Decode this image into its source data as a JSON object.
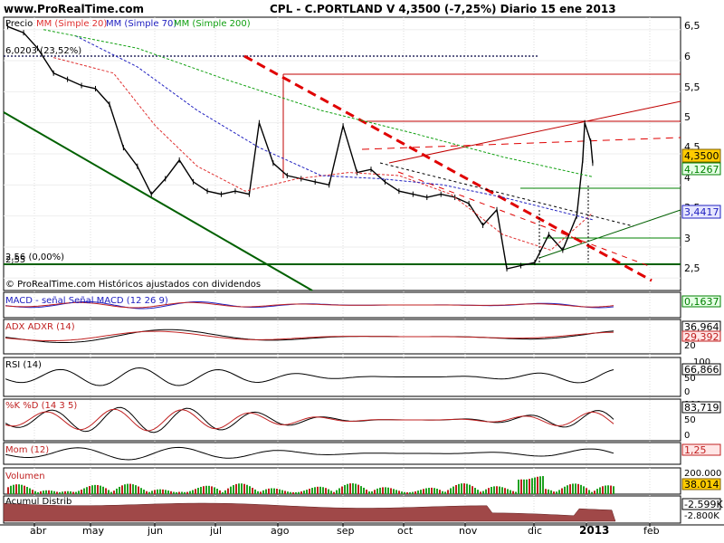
{
  "header": {
    "site": "www.ProRealTime.com",
    "title": "CPL - C.PORTLAND V    4,3500 (-7,25%)   Diario  15 ene 2013"
  },
  "main_panel": {
    "legend": [
      {
        "text": "Precio",
        "color": "#000000"
      },
      {
        "text": "MM (Simple 20)",
        "color": "#e03030"
      },
      {
        "text": "MM (Simple 70)",
        "color": "#2020c0"
      },
      {
        "text": "MM (Simple 200)",
        "color": "#10a010"
      }
    ],
    "annotations": {
      "fib_top": "6,0203 (23,52%)",
      "fib_bottom": "2,56 (0,00%)",
      "fib_bottom_shadow": "2,55",
      "watermark": "© ProRealTime.com Históricos ajustados con dividendos"
    },
    "y_ticks": [
      "6,5",
      "6",
      "5,5",
      "5",
      "4,5",
      "4",
      "3,5",
      "3",
      "2,5"
    ],
    "value_tags": [
      {
        "text": "4,3500",
        "bg": "#ffcc00",
        "fg": "#000000",
        "border": "#806000"
      },
      {
        "text": "4,1267",
        "bg": "#e6ffe6",
        "fg": "#008000",
        "border": "#008000"
      },
      {
        "text": "3,4417",
        "bg": "#e6e6ff",
        "fg": "#2020c0",
        "border": "#2020c0"
      }
    ]
  },
  "indicators": [
    {
      "label": "MACD - señal Señal MACD (12 26 9)",
      "value": "0,1637",
      "value_color": "#008000",
      "axis": []
    },
    {
      "label": "ADX  ADXR (14)",
      "value": "36,964",
      "value_color": "#000000",
      "value2": "29,392",
      "axis": [
        "40",
        "20"
      ]
    },
    {
      "label": "RSI (14)",
      "value": "66,866",
      "value_color": "#000000",
      "axis": [
        "100",
        "50",
        "0"
      ]
    },
    {
      "label": "%K  %D (14 3 5)",
      "value": "83,719",
      "value_color": "#000000",
      "axis": [
        "100",
        "50",
        "0"
      ]
    },
    {
      "label": "Mom (12)",
      "value": "1,25",
      "value_color": "#c02020",
      "axis": []
    },
    {
      "label": "Volumen",
      "value": "38.014",
      "value_color": "#000000",
      "axis": [
        "200.000"
      ]
    },
    {
      "label": "Acumul Distrib",
      "value": "-2.599K",
      "value_color": "#000000",
      "axis": [
        "-2.800K"
      ]
    }
  ],
  "x_axis": {
    "months": [
      "abr",
      "may",
      "jun",
      "jul",
      "ago",
      "sep",
      "oct",
      "nov",
      "dic",
      "2013",
      "feb"
    ]
  },
  "chart_data": {
    "type": "line",
    "title": "CPL - C.PORTLAND V    4,3500 (-7,25%)   Diario  15 ene 2013",
    "x_label": "",
    "y_label": "",
    "ylim": [
      2.3,
      6.7
    ],
    "x_range": [
      "2012-03-26",
      "2013-02-28"
    ],
    "series": [
      {
        "name": "Precio",
        "color": "#000000",
        "points": [
          [
            "2012-03-28",
            6.55
          ],
          [
            "2012-04-05",
            6.45
          ],
          [
            "2012-04-12",
            6.2
          ],
          [
            "2012-04-20",
            5.8
          ],
          [
            "2012-04-27",
            5.7
          ],
          [
            "2012-05-04",
            5.6
          ],
          [
            "2012-05-11",
            5.55
          ],
          [
            "2012-05-18",
            5.3
          ],
          [
            "2012-05-25",
            4.6
          ],
          [
            "2012-06-01",
            4.3
          ],
          [
            "2012-06-08",
            3.85
          ],
          [
            "2012-06-15",
            4.1
          ],
          [
            "2012-06-22",
            4.4
          ],
          [
            "2012-06-29",
            4.05
          ],
          [
            "2012-07-06",
            3.9
          ],
          [
            "2012-07-13",
            3.85
          ],
          [
            "2012-07-20",
            3.9
          ],
          [
            "2012-07-27",
            3.85
          ],
          [
            "2012-08-01",
            5.0
          ],
          [
            "2012-08-08",
            4.35
          ],
          [
            "2012-08-15",
            4.15
          ],
          [
            "2012-08-22",
            4.1
          ],
          [
            "2012-08-29",
            4.05
          ],
          [
            "2012-09-05",
            4.0
          ],
          [
            "2012-09-12",
            4.95
          ],
          [
            "2012-09-19",
            4.2
          ],
          [
            "2012-09-26",
            4.25
          ],
          [
            "2012-10-03",
            4.05
          ],
          [
            "2012-10-10",
            3.9
          ],
          [
            "2012-10-17",
            3.85
          ],
          [
            "2012-10-24",
            3.8
          ],
          [
            "2012-10-31",
            3.85
          ],
          [
            "2012-11-07",
            3.8
          ],
          [
            "2012-11-14",
            3.7
          ],
          [
            "2012-11-21",
            3.35
          ],
          [
            "2012-11-28",
            3.6
          ],
          [
            "2012-12-03",
            2.65
          ],
          [
            "2012-12-10",
            2.7
          ],
          [
            "2012-12-17",
            2.75
          ],
          [
            "2012-12-24",
            3.2
          ],
          [
            "2012-12-31",
            2.95
          ],
          [
            "2013-01-07",
            3.5
          ],
          [
            "2013-01-10",
            4.4
          ],
          [
            "2013-01-11",
            5.0
          ],
          [
            "2013-01-14",
            4.7
          ],
          [
            "2013-01-15",
            4.35
          ]
        ]
      },
      {
        "name": "MM (Simple 20)",
        "color": "#e03030",
        "points": [
          [
            "2012-04-20",
            6.05
          ],
          [
            "2012-05-20",
            5.8
          ],
          [
            "2012-06-10",
            4.95
          ],
          [
            "2012-07-01",
            4.3
          ],
          [
            "2012-07-25",
            3.9
          ],
          [
            "2012-08-20",
            4.1
          ],
          [
            "2012-09-15",
            4.2
          ],
          [
            "2012-10-10",
            4.15
          ],
          [
            "2012-11-05",
            3.85
          ],
          [
            "2012-12-01",
            3.2
          ],
          [
            "2012-12-25",
            2.95
          ],
          [
            "2013-01-15",
            3.55
          ]
        ]
      },
      {
        "name": "MM (Simple 70)",
        "color": "#2020c0",
        "points": [
          [
            "2012-05-01",
            6.4
          ],
          [
            "2012-06-01",
            5.9
          ],
          [
            "2012-07-01",
            5.2
          ],
          [
            "2012-08-01",
            4.6
          ],
          [
            "2012-09-01",
            4.15
          ],
          [
            "2012-10-01",
            4.1
          ],
          [
            "2012-11-01",
            4.0
          ],
          [
            "2012-12-01",
            3.8
          ],
          [
            "2013-01-15",
            3.44
          ]
        ]
      },
      {
        "name": "MM (Simple 200)",
        "color": "#10a010",
        "points": [
          [
            "2012-04-15",
            6.5
          ],
          [
            "2012-06-01",
            6.2
          ],
          [
            "2012-07-15",
            5.7
          ],
          [
            "2012-09-01",
            5.2
          ],
          [
            "2012-10-15",
            4.85
          ],
          [
            "2012-12-01",
            4.45
          ],
          [
            "2013-01-15",
            4.13
          ]
        ]
      }
    ],
    "current_price": 4.35,
    "change_pct": -7.25
  }
}
